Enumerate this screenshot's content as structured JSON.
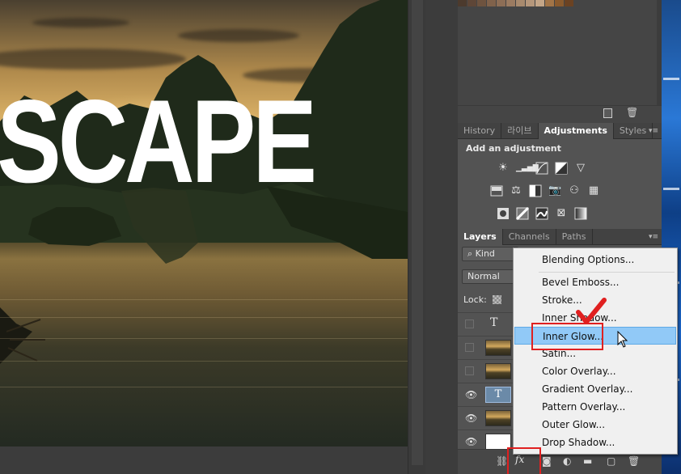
{
  "canvas": {
    "title_text": "SCAPE"
  },
  "swatches": {
    "colors": [
      "#4c3a2d",
      "#5e4637",
      "#6e533f",
      "#80624b",
      "#8d6e56",
      "#9b7b61",
      "#a88a6e",
      "#b5977b",
      "#c4a688",
      "#a27447",
      "#8a5a2d",
      "#6b4222"
    ]
  },
  "adjust_tabs": {
    "tabs": [
      {
        "label": "History"
      },
      {
        "label": "라이브"
      },
      {
        "label": "Adjustments"
      },
      {
        "label": "Styles"
      }
    ],
    "menu_glyph": "▾≡"
  },
  "adjustments": {
    "heading": "Add an adjustment",
    "row1": [
      "brightness-icon",
      "levels-icon",
      "curves-icon",
      "exposure-icon",
      "vibrance-icon"
    ],
    "row2": [
      "hue-sat-icon",
      "color-balance-icon",
      "black-white-icon",
      "photo-filter-icon",
      "channel-mixer-icon",
      "color-lookup-icon"
    ],
    "row3": [
      "invert-icon",
      "posterize-icon",
      "threshold-icon",
      "selective-color-icon",
      "gradient-map-icon"
    ]
  },
  "layers_tabs": {
    "tabs": [
      {
        "label": "Layers"
      },
      {
        "label": "Channels"
      },
      {
        "label": "Paths"
      }
    ],
    "menu_glyph": "▾≡"
  },
  "layers": {
    "filter_label": "Kind",
    "filter_icon_glyph": "⌕",
    "blend_mode": "Normal",
    "lock_label": "Lock:",
    "type_glyph": "T",
    "eye_glyph": "👁"
  },
  "context_menu": {
    "items": [
      {
        "label": "Blending Options...",
        "highlighted": false
      },
      {
        "label": "Bevel  Emboss...",
        "highlighted": false
      },
      {
        "label": "Stroke...",
        "highlighted": false
      },
      {
        "label": "Inner Shadow...",
        "highlighted": false
      },
      {
        "label": "Inner Glow...",
        "highlighted": true
      },
      {
        "label": "Satin...",
        "highlighted": false
      },
      {
        "label": "Color Overlay...",
        "highlighted": false
      },
      {
        "label": "Gradient Overlay...",
        "highlighted": false
      },
      {
        "label": "Pattern Overlay...",
        "highlighted": false
      },
      {
        "label": "Outer Glow...",
        "highlighted": false
      },
      {
        "label": "Drop Shadow...",
        "highlighted": false
      }
    ]
  },
  "footer": {
    "fx_label": "fx"
  },
  "colors": {
    "annotation_red": "#e02020",
    "menu_highlight": "#91c9f7"
  }
}
